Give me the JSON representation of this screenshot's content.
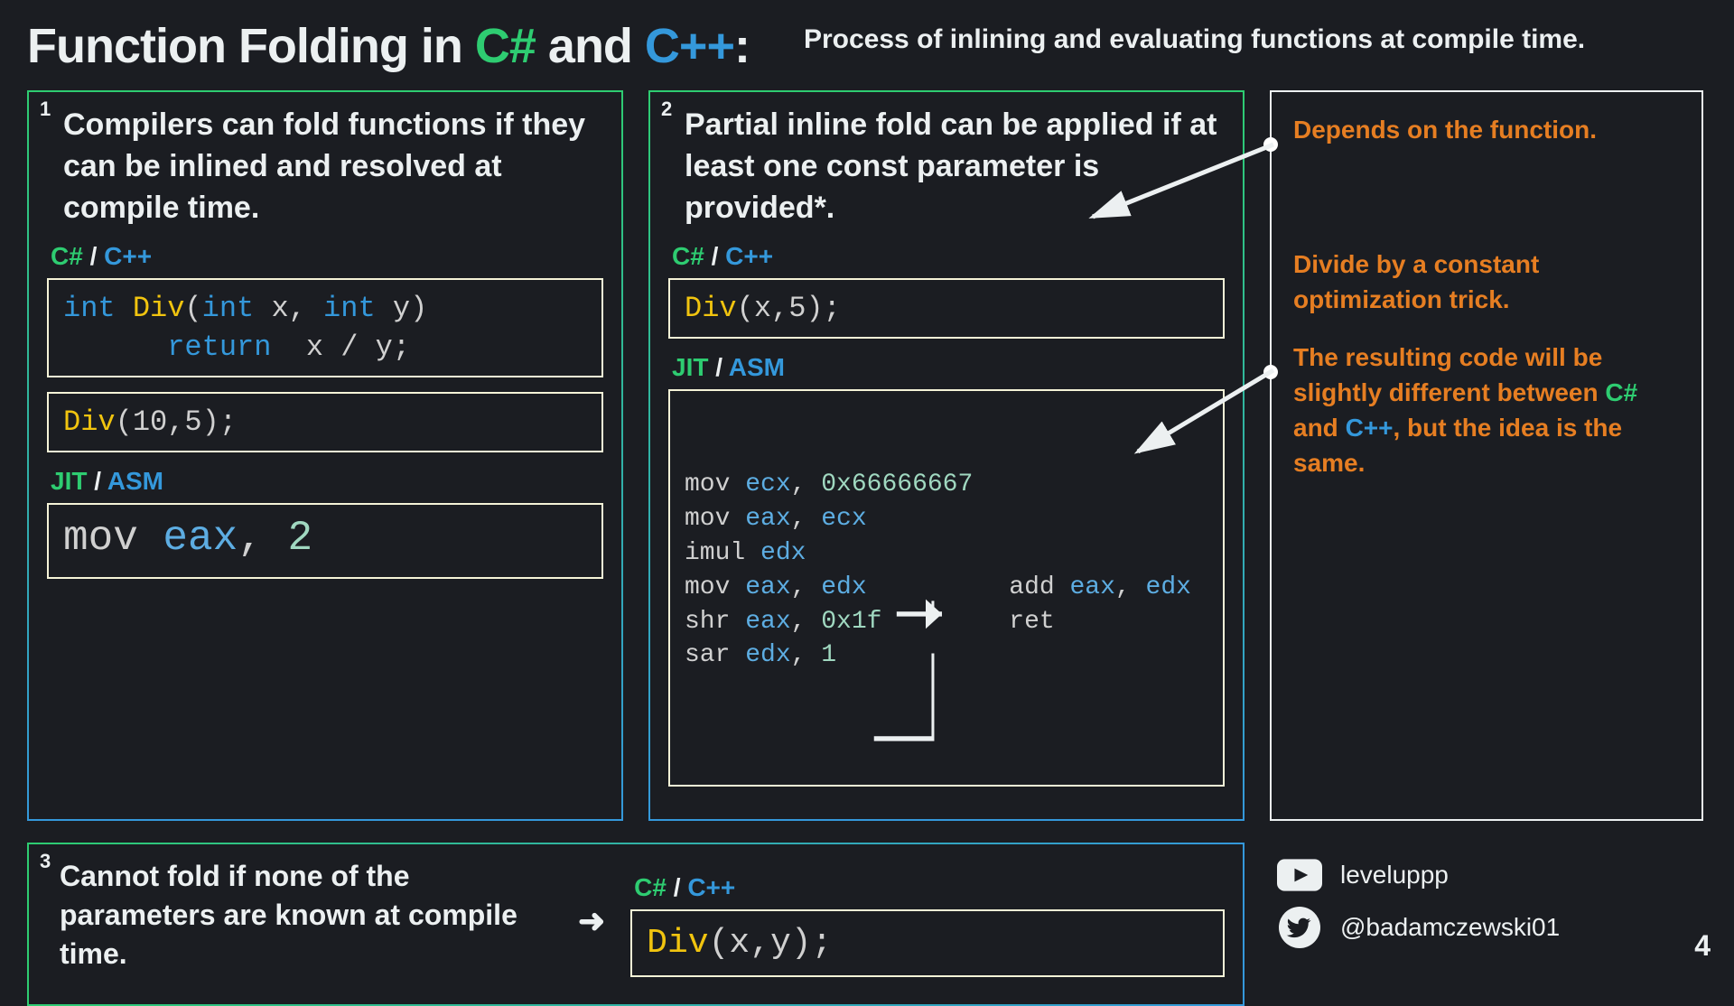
{
  "header": {
    "title_prefix": "Function Folding in ",
    "lang1": "C#",
    "and": " and ",
    "lang2": "C++",
    "colon": ":",
    "subtitle": "Process of inlining and evaluating functions at compile time."
  },
  "box1": {
    "num": "1",
    "text": "Compilers can fold functions if they can be inlined and resolved at compile time.",
    "langlabel_a": "C#",
    "langlabel_sep": " / ",
    "langlabel_b": "C++",
    "code1": {
      "line1_a": "int",
      "line1_b": " Div",
      "line1_c": "(",
      "line1_d": "int",
      "line1_e": " x, ",
      "line1_f": "int",
      "line1_g": " y)",
      "line2_a": "      return",
      "line2_b": "  x / y;"
    },
    "code2": {
      "a": "Div",
      "b": "(10,5);"
    },
    "jitlabel_a": "JIT",
    "jitlabel_sep": " / ",
    "jitlabel_b": "ASM",
    "asm": {
      "a": "mov ",
      "b": "eax",
      "c": ", ",
      "d": "2"
    }
  },
  "box2": {
    "num": "2",
    "text": "Partial inline fold can be applied if at least one const parameter is provided*.",
    "langlabel_a": "C#",
    "langlabel_sep": " / ",
    "langlabel_b": "C++",
    "code1": {
      "a": "Div",
      "b": "(x,5);"
    },
    "jitlabel_a": "JIT",
    "jitlabel_sep": " / ",
    "jitlabel_b": "ASM",
    "asm_left": [
      {
        "op": "mov ",
        "r": "ecx",
        "c": ", ",
        "v": "0x66666667"
      },
      {
        "op": "mov ",
        "r": "eax",
        "c": ", ",
        "r2": "ecx"
      },
      {
        "op": "imul ",
        "r": "edx"
      },
      {
        "op": "mov ",
        "r": "eax",
        "c": ", ",
        "r2": "edx"
      },
      {
        "op": "shr ",
        "r": "eax",
        "c": ", ",
        "v": "0x1f"
      },
      {
        "op": "sar ",
        "r": "edx",
        "c": ", ",
        "v": "1"
      }
    ],
    "asm_right": [
      {
        "op": "add ",
        "r": "eax",
        "c": ", ",
        "r2": "edx"
      },
      {
        "op": "ret"
      }
    ]
  },
  "side": {
    "note1": "Depends on the function.",
    "note2": "Divide by a constant optimization trick.",
    "note3a": "The resulting code will be slightly different between ",
    "note3_cs": "C#",
    "note3_and": " and ",
    "note3_cpp": "C++",
    "note3b": ", but the idea is the same."
  },
  "box3": {
    "num": "3",
    "text": "Cannot fold if none of the parameters are known at compile time.",
    "arrow": "➜",
    "langlabel_a": "C#",
    "langlabel_sep": " / ",
    "langlabel_b": "C++",
    "code": {
      "a": "Div",
      "b": "(x,y);"
    }
  },
  "social": {
    "youtube": "leveluppp",
    "twitter": "@badamczewski01"
  },
  "page": "4"
}
